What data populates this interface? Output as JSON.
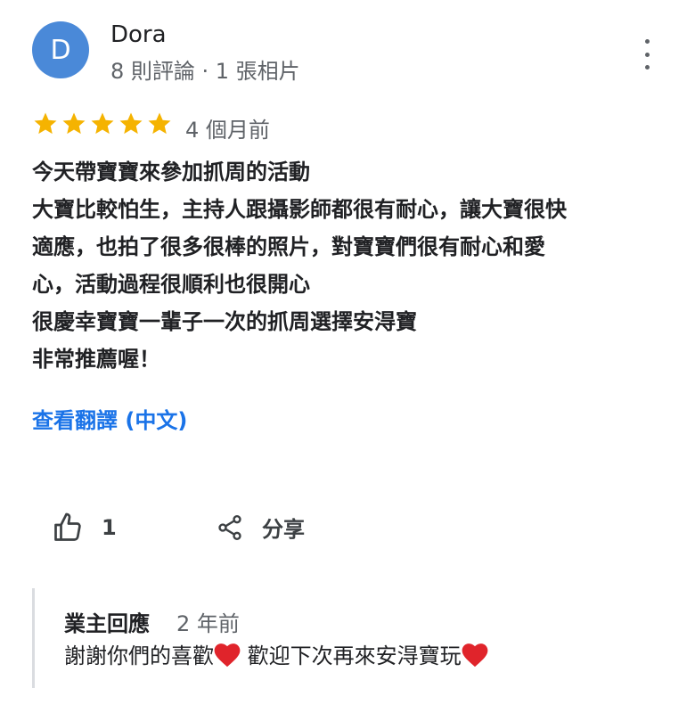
{
  "review": {
    "avatar_letter": "D",
    "avatar_color": "#4a89d8",
    "author": "Dora",
    "meta": "8 則評論 · 1 張相片",
    "rating": 5,
    "star_color": "#f5b301",
    "date": "4 個月前",
    "text_lines": [
      "今天帶寶寶來參加抓周的活動",
      "大寶比較怕生，主持人跟攝影師都很有耐心，讓大寶很快",
      "適應，也拍了很多很棒的照片，對寶寶們很有耐心和愛",
      "心，活動過程很順利也很開心",
      "很慶幸寶寶一輩子一次的抓周選擇安淂寶",
      "非常推薦喔！"
    ],
    "translate_link": "查看翻譯 (中文)",
    "like_count": "1",
    "share_label": "分享"
  },
  "owner_reply": {
    "title": "業主回應",
    "date": "2 年前",
    "text_part1": "謝謝你們的喜歡",
    "text_part2": " 歡迎下次再來安淂寶玩"
  }
}
